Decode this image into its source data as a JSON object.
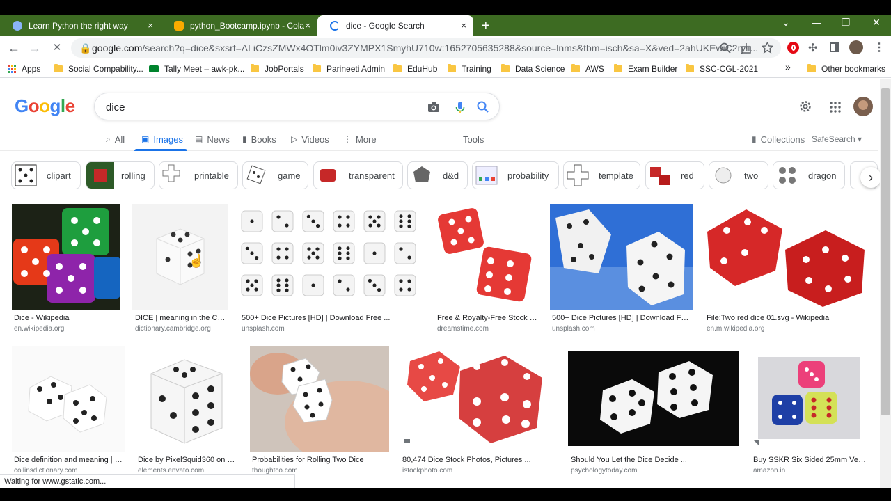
{
  "browser": {
    "tabs": [
      {
        "title": "Learn Python the right way",
        "close": "×"
      },
      {
        "title": "python_Bootcamp.ipynb - Colab",
        "close": "×"
      },
      {
        "title": "dice - Google Search",
        "close": "×"
      }
    ],
    "new_tab": "+",
    "window_controls": {
      "tab_search": "⌄",
      "minimize": "—",
      "restore": "❐",
      "close": "✕"
    },
    "nav": {
      "back": "←",
      "forward": "→",
      "stop": "✕"
    },
    "url_host": "google.com",
    "url_rest": "/search?q=dice&sxsrf=ALiCzsZMWx4OTlm0iv3ZYMPX1SmyhU710w:1652705635288&source=lnms&tbm=isch&sa=X&ved=2ahUKEwiC2ryii...",
    "bookmarks": [
      {
        "label": "Apps",
        "icon": "apps-grid-icon"
      },
      {
        "label": "Social Compability...",
        "icon": "folder-icon"
      },
      {
        "label": "Tally Meet – awk-pk...",
        "icon": "meet-icon"
      },
      {
        "label": "JobPortals",
        "icon": "folder-icon"
      },
      {
        "label": "Parineeti Admin",
        "icon": "folder-icon"
      },
      {
        "label": "EduHub",
        "icon": "folder-icon"
      },
      {
        "label": "Training",
        "icon": "folder-icon"
      },
      {
        "label": "Data Science",
        "icon": "folder-icon"
      },
      {
        "label": "AWS",
        "icon": "folder-icon"
      },
      {
        "label": "Exam Builder",
        "icon": "folder-icon"
      },
      {
        "label": "SSC-CGL-2021",
        "icon": "folder-icon"
      }
    ],
    "bookmarks_more": "»",
    "other_bookmarks": "Other bookmarks",
    "status_text": "Waiting for www.gstatic.com..."
  },
  "google": {
    "logo_letters": [
      "G",
      "o",
      "o",
      "g",
      "l",
      "e"
    ],
    "logo_colors": [
      "#4285f4",
      "#ea4335",
      "#fbbc05",
      "#4285f4",
      "#34a853",
      "#ea4335"
    ],
    "query": "dice",
    "nav_tabs": [
      {
        "label": "All",
        "icon": "search-icon"
      },
      {
        "label": "Images",
        "icon": "image-icon"
      },
      {
        "label": "News",
        "icon": "news-icon"
      },
      {
        "label": "Books",
        "icon": "book-icon"
      },
      {
        "label": "Videos",
        "icon": "video-icon"
      },
      {
        "label": "More",
        "icon": "more-vert-icon"
      }
    ],
    "tools": "Tools",
    "collections": "Collections",
    "safesearch": "SafeSearch ▾",
    "chips": [
      "clipart",
      "rolling",
      "printable",
      "game",
      "transparent",
      "d&d",
      "probability",
      "template",
      "red",
      "two",
      "dragon"
    ],
    "results": [
      {
        "title": "Dice - Wikipedia",
        "source": "en.wikipedia.org"
      },
      {
        "title": "DICE | meaning in the Ca...",
        "source": "dictionary.cambridge.org"
      },
      {
        "title": "500+ Dice Pictures [HD] | Download Free ...",
        "source": "unsplash.com"
      },
      {
        "title": "Free & Royalty-Free Stock Ph...",
        "source": "dreamstime.com"
      },
      {
        "title": "500+ Dice Pictures [HD] | Download Free ...",
        "source": "unsplash.com"
      },
      {
        "title": "File:Two red dice 01.svg - Wikipedia",
        "source": "en.m.wikipedia.org"
      },
      {
        "title": "Dice definition and meaning | C...",
        "source": "collinsdictionary.com"
      },
      {
        "title": "Dice by PixelSquid360 on En...",
        "source": "elements.envato.com"
      },
      {
        "title": "Probabilities for Rolling Two Dice",
        "source": "thoughtco.com"
      },
      {
        "title": "80,474 Dice Stock Photos, Pictures ...",
        "source": "istockphoto.com"
      },
      {
        "title": "Should You Let the Dice Decide ...",
        "source": "psychologytoday.com"
      },
      {
        "title": "Buy SSKR Six Sided 25mm Very ...",
        "source": "amazon.in"
      }
    ]
  }
}
